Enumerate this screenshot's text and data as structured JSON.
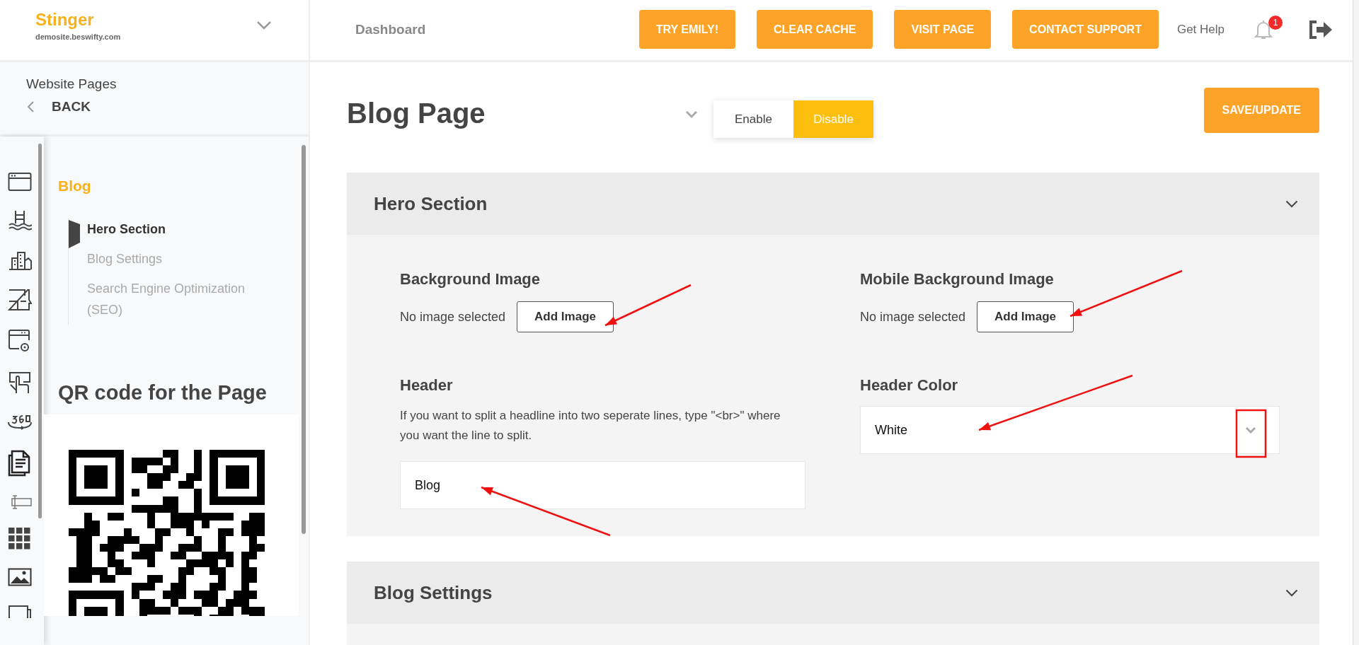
{
  "brand": {
    "name": "Stinger",
    "domain": "demosite.beswifty.com"
  },
  "topbar": {
    "breadcrumb": "Dashboard",
    "buttons": [
      "TRY EMILY!",
      "CLEAR CACHE",
      "VISIT PAGE",
      "CONTACT SUPPORT"
    ],
    "help_link": "Get Help",
    "notification_count": "1"
  },
  "sidebar": {
    "heading": "Website Pages",
    "back": "BACK",
    "section": "Blog",
    "items": [
      {
        "label": "Hero Section",
        "selected": true
      },
      {
        "label": "Blog Settings",
        "selected": false
      },
      {
        "label": "Search Engine Optimization (SEO)",
        "selected": false
      }
    ],
    "qr_title": "QR code for the Page"
  },
  "page": {
    "title": "Blog Page",
    "toggle": [
      {
        "label": "Enable",
        "selected": false
      },
      {
        "label": "Disable",
        "selected": true
      }
    ],
    "save_button": "SAVE/UPDATE"
  },
  "sections": [
    {
      "title": "Hero Section",
      "fields": [
        {
          "kind": "image",
          "label": "Background Image",
          "status": "No image selected",
          "button": "Add Image"
        },
        {
          "kind": "image",
          "label": "Mobile Background Image",
          "status": "No image selected",
          "button": "Add Image"
        },
        {
          "kind": "text",
          "label": "Header",
          "hint": "If you want to split a headline into two seperate lines, type \"<br>\" where you want the line to split.",
          "value": "Blog"
        },
        {
          "kind": "select",
          "label": "Header Color",
          "value": "White"
        }
      ]
    },
    {
      "title": "Blog Settings"
    }
  ]
}
